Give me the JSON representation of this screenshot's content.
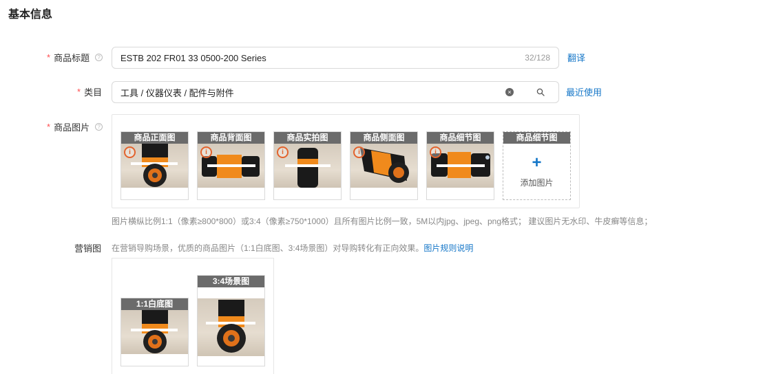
{
  "section": {
    "title": "基本信息"
  },
  "product_title": {
    "label": "商品标题",
    "value": "ESTB 202 FR01 33 0500-200 Series",
    "counter": "32/128",
    "translate_link": "翻译"
  },
  "category": {
    "label": "类目",
    "value": "工具 / 仪器仪表 / 配件与附件",
    "recent_link": "最近使用"
  },
  "product_images": {
    "label": "商品图片",
    "slots": [
      {
        "caption": "商品正面图",
        "view": "front"
      },
      {
        "caption": "商品背面图",
        "view": "side"
      },
      {
        "caption": "商品实拍图",
        "view": "upright"
      },
      {
        "caption": "商品侧面图",
        "view": "angled"
      },
      {
        "caption": "商品细节图",
        "view": "side"
      }
    ],
    "add_slot": {
      "caption": "商品细节图",
      "plus": "+",
      "text": "添加图片"
    },
    "hint": "图片横纵比例1:1（像素≥800*800）或3:4（像素≥750*1000）且所有图片比例一致，5M以内jpg、jpeg、png格式； 建议图片无水印、牛皮癣等信息；"
  },
  "marketing": {
    "label": "营销图",
    "desc": "在营销导购场景，优质的商品图片（1:1白底图、3:4场景图）对导购转化有正向效果。",
    "rules_link": "图片规则说明",
    "slots": [
      {
        "caption": "1:1白底图"
      },
      {
        "caption": "3:4场景图"
      }
    ]
  },
  "icons": {
    "help": "question-circle-icon",
    "clear": "close-circle-icon",
    "search": "search-icon",
    "warning": "info-circle-icon"
  },
  "colors": {
    "required": "#ff4d4f",
    "link": "#1677c8",
    "caption_bg": "#6b6b6b",
    "warning": "#e3622c"
  }
}
